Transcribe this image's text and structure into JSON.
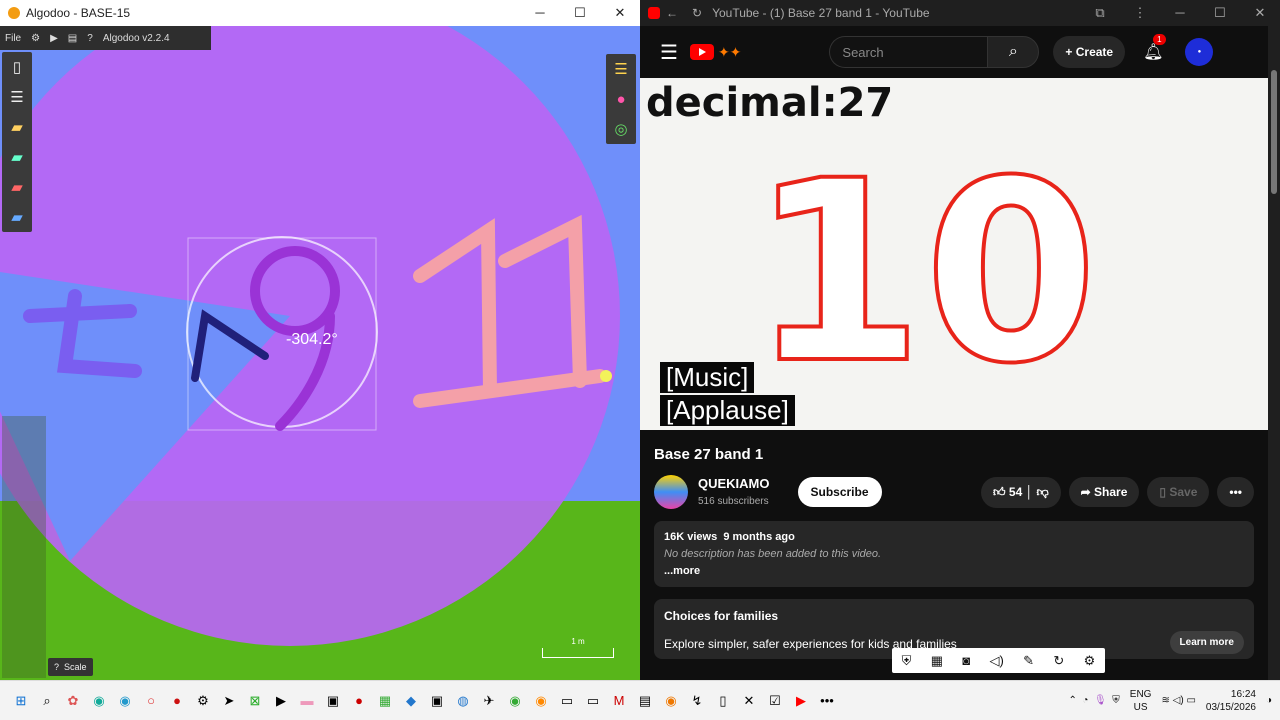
{
  "algodoo": {
    "window_title": "Algodoo - BASE-15",
    "menu": {
      "file": "File",
      "version": "Algodoo v2.2.4",
      "help": "?"
    },
    "angle_readout": "-304.2°",
    "scale_label": "Scale",
    "scale_help": "?",
    "meter_label": "1 m"
  },
  "youtube": {
    "window_title": "YouTube - (1) Base 27 band 1 - YouTube",
    "search_placeholder": "Search",
    "create_label": "Create",
    "notifications_count": "1",
    "video": {
      "overlay_text": "decimal:27",
      "number": "10",
      "captions": [
        "[Music]",
        "[Applause]"
      ]
    },
    "title": "Base 27 band 1",
    "channel": {
      "name": "QUEKIAMO",
      "subscribers": "516 subscribers"
    },
    "subscribe_label": "Subscribe",
    "likes": "54",
    "share_label": "Share",
    "save_label": "Save",
    "description": {
      "views": "16K views",
      "date": "9 months ago",
      "text": "No description has been added to this video.",
      "more": "...more"
    },
    "families": {
      "title": "Choices for families",
      "text": "Explore simpler, safer experiences for kids and families",
      "button": "Learn more"
    }
  },
  "taskbar": {
    "language": "ENG",
    "region": "US",
    "time": "16:24",
    "date": "03/15/2026"
  },
  "colors": {
    "canvas_blue": "#6f8ffa",
    "disk_purple": "#b866f4",
    "ground_green": "#58b61a",
    "yt_red": "#ff0000",
    "number_outline": "#e8241a"
  }
}
